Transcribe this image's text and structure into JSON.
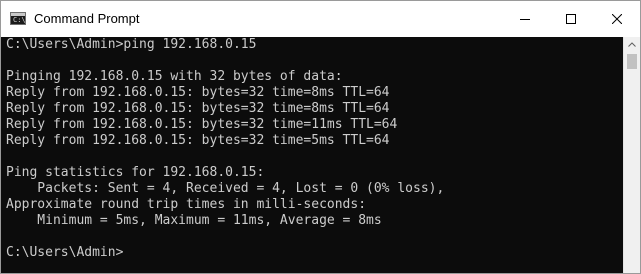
{
  "window": {
    "title": "Command Prompt",
    "icon": "command-prompt-icon",
    "icon_glyph": "C:\\",
    "controls": [
      "minimize-icon",
      "maximize-icon",
      "close-icon"
    ]
  },
  "console": {
    "lines": [
      "C:\\Users\\Admin>ping 192.168.0.15",
      "",
      "Pinging 192.168.0.15 with 32 bytes of data:",
      "Reply from 192.168.0.15: bytes=32 time=8ms TTL=64",
      "Reply from 192.168.0.15: bytes=32 time=8ms TTL=64",
      "Reply from 192.168.0.15: bytes=32 time=11ms TTL=64",
      "Reply from 192.168.0.15: bytes=32 time=5ms TTL=64",
      "",
      "Ping statistics for 192.168.0.15:",
      "    Packets: Sent = 4, Received = 4, Lost = 0 (0% loss),",
      "Approximate round trip times in milli-seconds:",
      "    Minimum = 5ms, Maximum = 11ms, Average = 8ms",
      "",
      "C:\\Users\\Admin>"
    ]
  },
  "colors": {
    "console_background": "#0c0c0c",
    "console_text": "#cccccc",
    "titlebar_background": "#ffffff",
    "scrollbar_track": "#f0f0f0"
  }
}
